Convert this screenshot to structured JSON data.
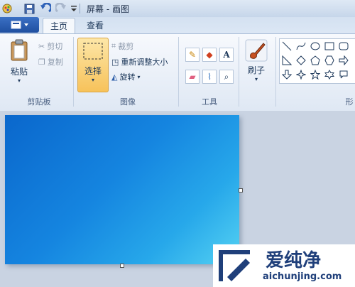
{
  "window": {
    "title": "屏幕 - 画图"
  },
  "tabs": [
    {
      "label": "主页"
    },
    {
      "label": "查看"
    }
  ],
  "clipboard": {
    "paste": "粘贴",
    "cut": "剪切",
    "copy": "复制",
    "group": "剪贴板"
  },
  "image": {
    "select": "选择",
    "crop": "裁剪",
    "resize": "重新调整大小",
    "rotate": "旋转",
    "group": "图像"
  },
  "tools": {
    "group": "工具"
  },
  "brushes": {
    "label": "刷子"
  },
  "shapes": {
    "group_partial": "形"
  },
  "watermark": {
    "brand": "爱纯净",
    "url": "aichunjing.com"
  },
  "colors": {
    "canvas_start": "#0a67cc",
    "canvas_end": "#55d2f3",
    "select_highlight": "#fbd37a"
  }
}
